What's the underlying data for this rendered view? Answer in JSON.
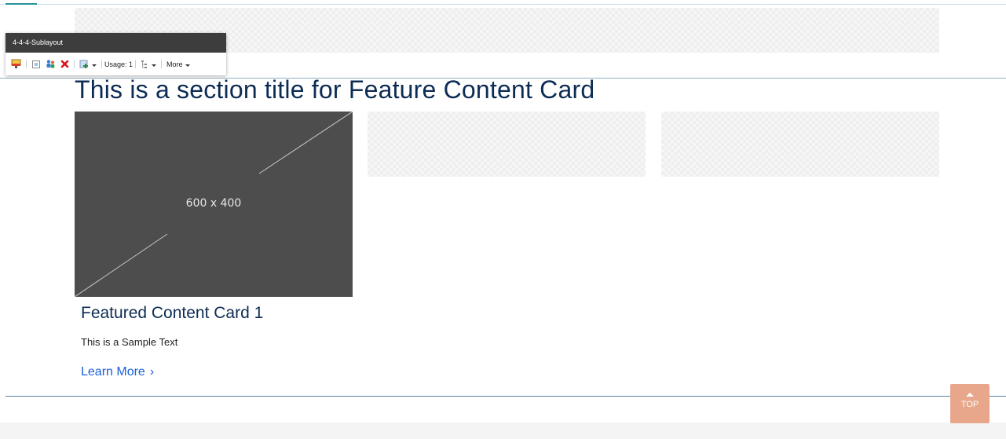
{
  "page": {
    "section_title": "This is a section title for Feature Content Card"
  },
  "chrome": {
    "title": "4-4-4-Sublayout",
    "usage_label": "Usage: 1",
    "more_label": "More"
  },
  "cards": [
    {
      "image_label": "600 x 400",
      "title": "Featured Content Card 1",
      "text": "This is a Sample Text",
      "link_label": "Learn More",
      "link_chevron": "›"
    }
  ],
  "scroll_top": {
    "label": "TOP"
  },
  "colors": {
    "heading": "#0d2c54",
    "link": "#1a5fd6",
    "image_bg": "#4d4d4d",
    "top_button": "#e8a68b",
    "chrome_title_bg": "#3d3d3d"
  },
  "icons": {
    "chrome_toolbar": [
      "edit-field-icon",
      "select-parent-icon",
      "personalize-icon",
      "delete-icon",
      "insert-icon",
      "tree-icon"
    ]
  }
}
